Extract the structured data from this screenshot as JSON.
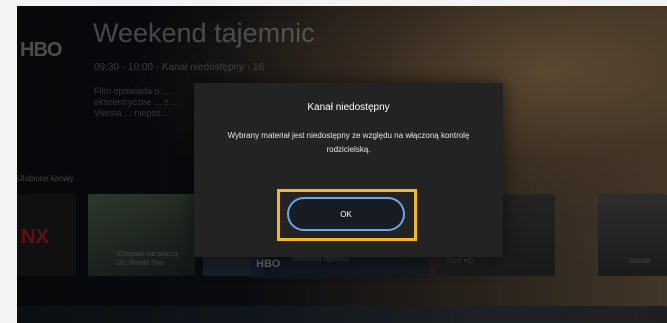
{
  "background": {
    "channel_logo": "HBO",
    "program_title": "Weekend tajemnic",
    "program_meta": "09:30 - 10:00 · Kanał niedostępny · 16",
    "program_description": "Film opowiada o ... ekscentryczne ... z ... Vienna ... niepoz...",
    "row_label": "Ulubione kanały",
    "tiles": [
      {
        "logo": "NX",
        "caption": ""
      },
      {
        "caption": "Chłopaki nie płaczą"
      },
      {
        "caption": "DC Retold Two"
      },
      {
        "logo": "HBO",
        "caption": "Weekend tajemnic"
      },
      {
        "caption": "FOX HD"
      },
      {
        "caption": "Szkoła"
      }
    ]
  },
  "dialog": {
    "title": "Kanał niedostępny",
    "message": "Wybrany materiał jest niedostępny ze względu na włączoną kontrolę rodzicielską.",
    "ok_label": "OK"
  },
  "colors": {
    "focus_ring": "#f5b820",
    "button_border": "#6aa7e6",
    "dialog_bg": "#232323"
  }
}
